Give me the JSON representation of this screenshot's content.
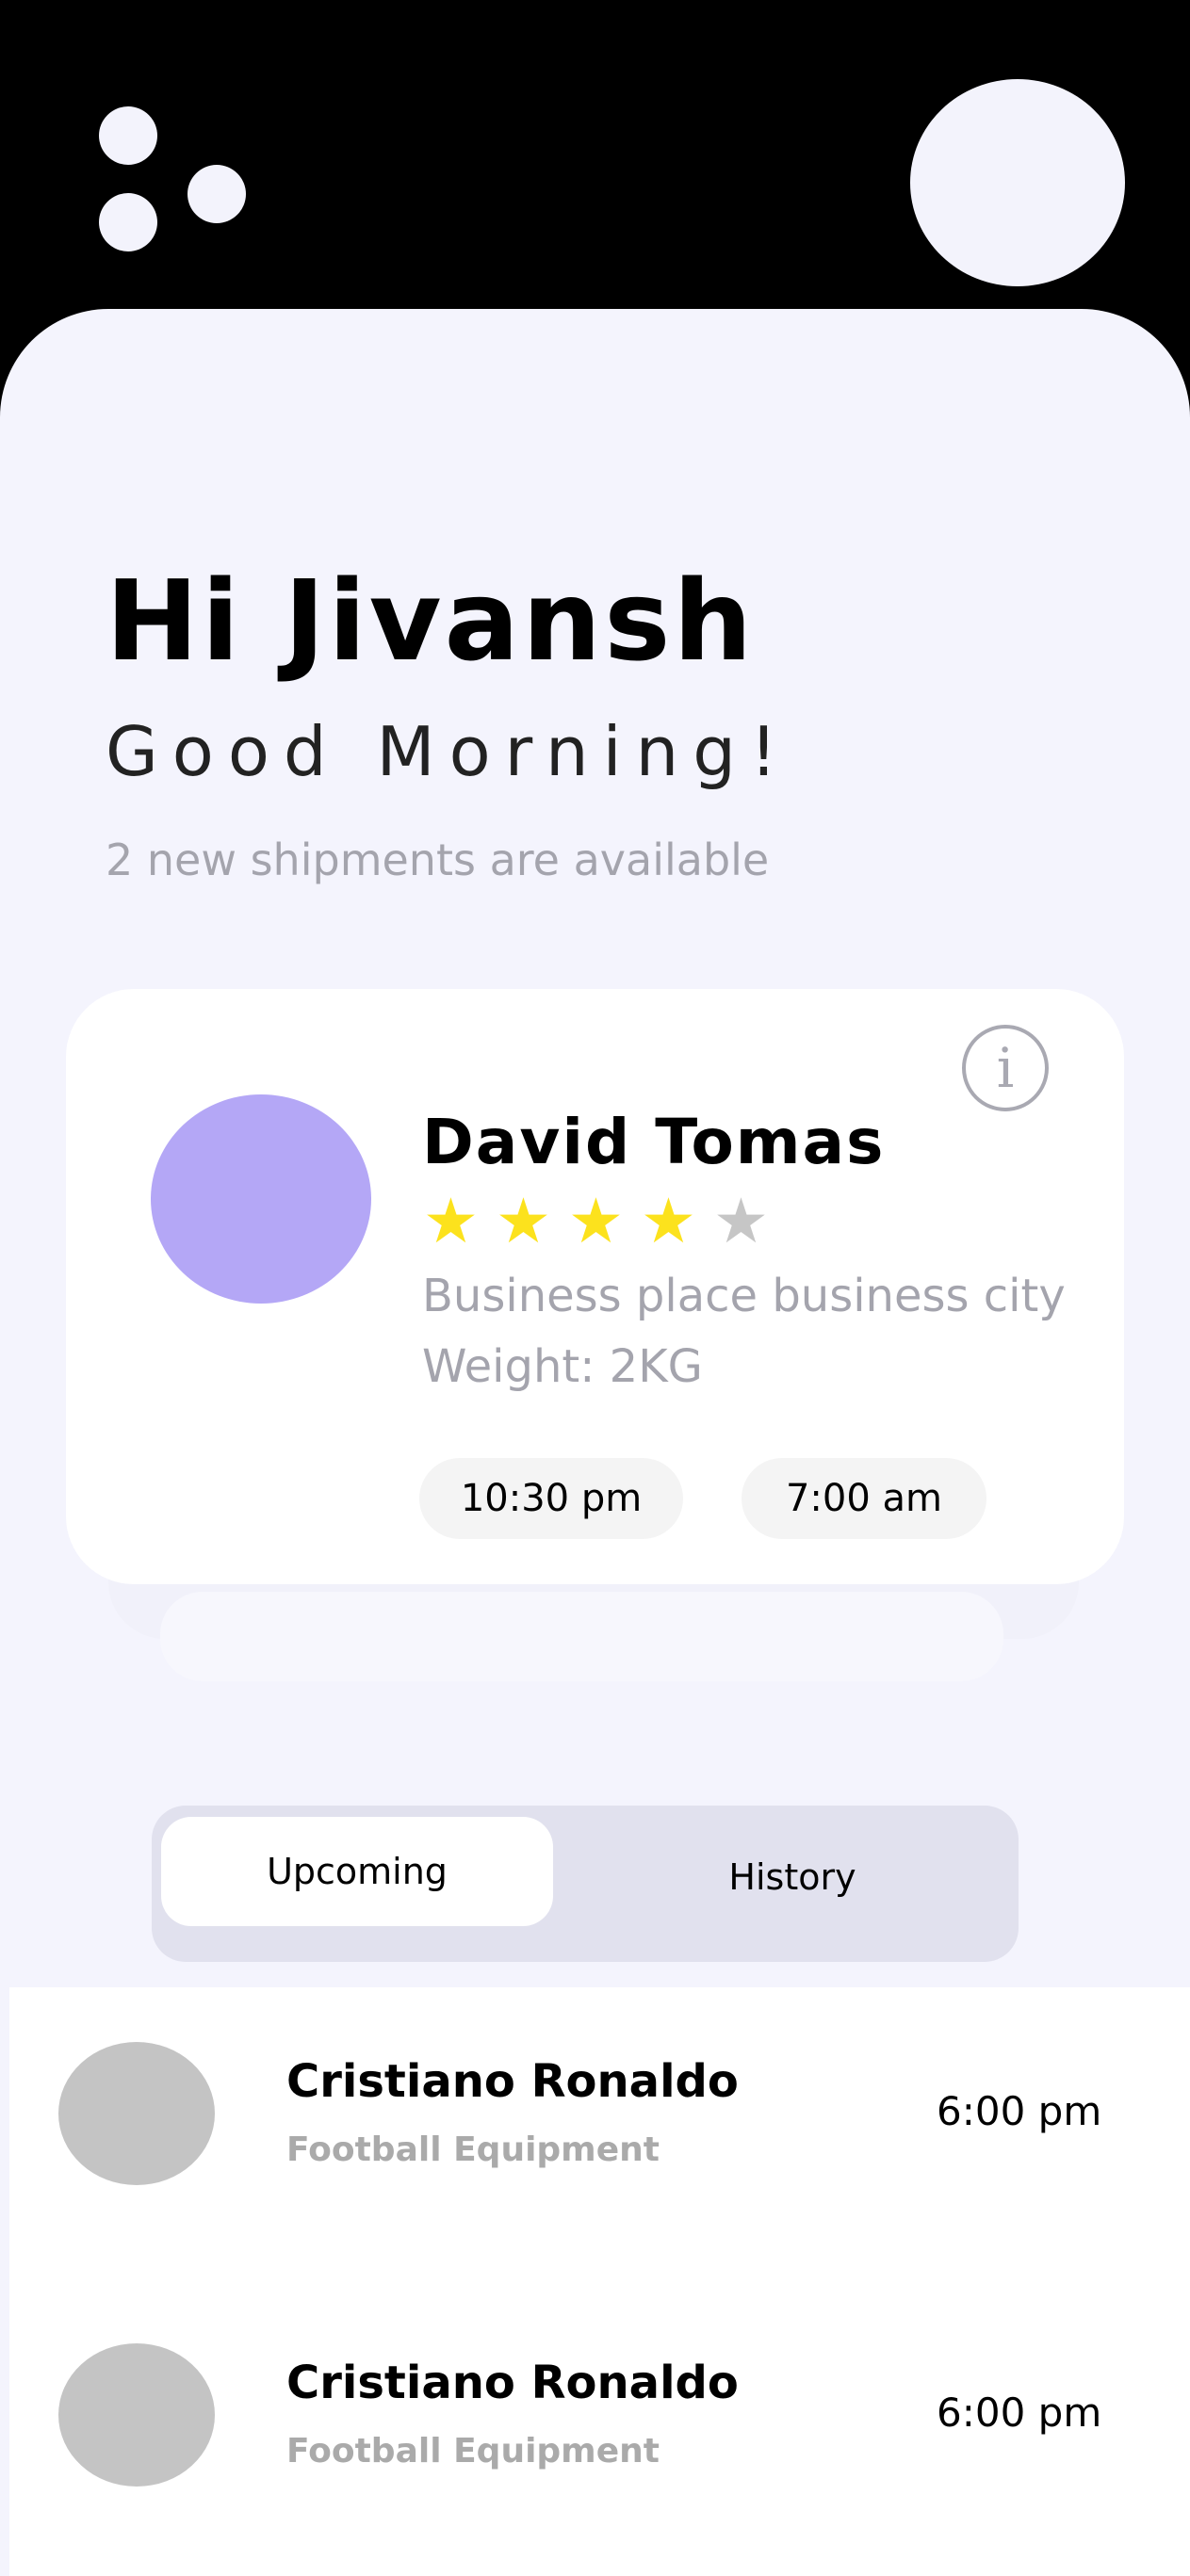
{
  "greeting": {
    "title": "Hi Jivansh",
    "subtitle": "Good Morning!",
    "note": "2 new shipments are available"
  },
  "card": {
    "info_icon": "i",
    "name": "David Tomas",
    "rating": {
      "value": 4,
      "max": 5,
      "star_glyph": "★",
      "filled_color": "#fce21d",
      "empty_color": "#c6c6c6"
    },
    "address": "Business place business city",
    "weight": "Weight: 2KG",
    "time_start": "10:30 pm",
    "time_end": "7:00 am",
    "avatar_color": "#b4a7f6"
  },
  "tabs": [
    {
      "label": "Upcoming",
      "active": true
    },
    {
      "label": "History",
      "active": false
    }
  ],
  "shipments": [
    {
      "name": "Cristiano Ronaldo",
      "category": "Football Equipment",
      "time": "6:00 pm"
    },
    {
      "name": "Cristiano Ronaldo",
      "category": "Football Equipment",
      "time": "6:00 pm"
    }
  ],
  "colors": {
    "background": "#f4f4fd",
    "header": "#000000",
    "accent_purple": "#b4a7f6",
    "star_yellow": "#fce21d",
    "muted_text": "#a4a4ad"
  },
  "icons": {
    "menu": "menu-dots-icon",
    "profile": "profile-avatar-icon",
    "info": "info-icon",
    "star": "star-icon"
  }
}
